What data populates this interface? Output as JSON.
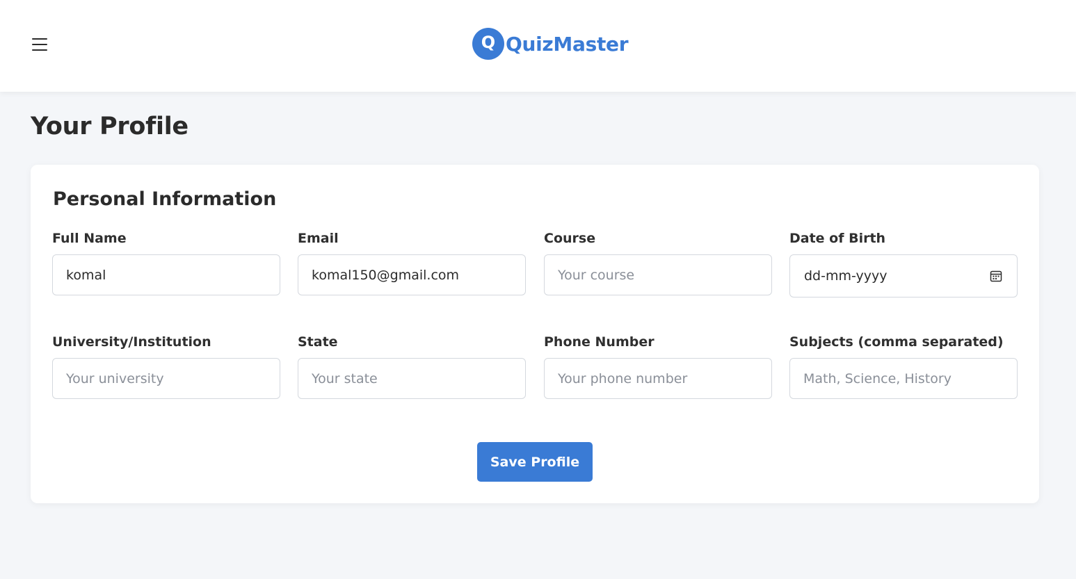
{
  "header": {
    "menu_icon": "hamburger-menu-icon",
    "logo_letter": "Q",
    "app_name": "QuizMaster",
    "brand_color": "#3a7bd5"
  },
  "page": {
    "title": "Your Profile"
  },
  "form": {
    "section_title": "Personal Information",
    "full_name": {
      "label": "Full Name",
      "value": "komal",
      "placeholder": ""
    },
    "email": {
      "label": "Email",
      "value": "komal150@gmail.com",
      "placeholder": ""
    },
    "course": {
      "label": "Course",
      "value": "",
      "placeholder": "Your course"
    },
    "dob": {
      "label": "Date of Birth",
      "value": "dd-mm-yyyy",
      "icon": "calendar-icon"
    },
    "university": {
      "label": "University/Institution",
      "value": "",
      "placeholder": "Your university"
    },
    "state": {
      "label": "State",
      "value": "",
      "placeholder": "Your state"
    },
    "phone": {
      "label": "Phone Number",
      "value": "",
      "placeholder": "Your phone number"
    },
    "subjects": {
      "label": "Subjects (comma separated)",
      "value": "",
      "placeholder": "Math, Science, History"
    },
    "save_label": "Save Profile"
  }
}
